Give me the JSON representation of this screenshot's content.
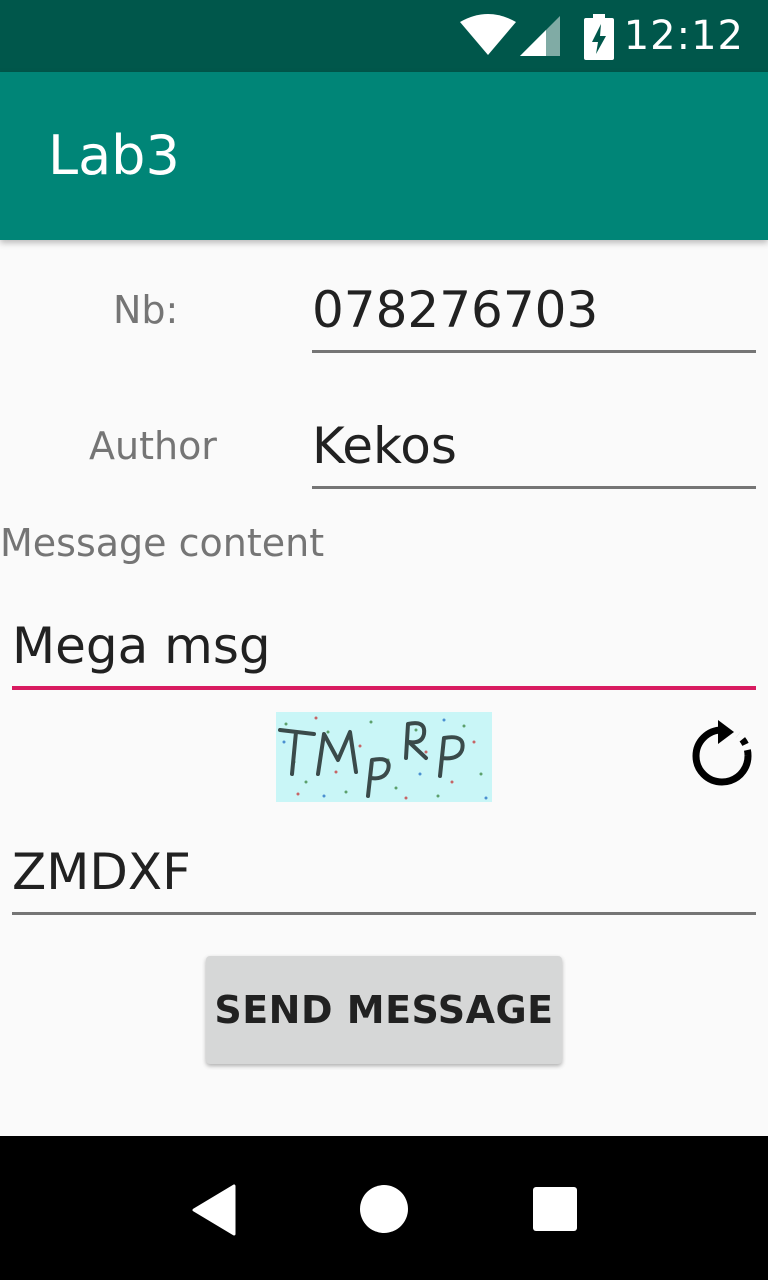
{
  "status_bar": {
    "time": "12:12",
    "icons": [
      "wifi-icon",
      "signal-icon",
      "battery-charging-icon"
    ]
  },
  "app_bar": {
    "title": "Lab3"
  },
  "form": {
    "nb_label": "Nb:",
    "nb_value": "078276703",
    "author_label": "Author",
    "author_value": "Kekos",
    "message_label": "Message content",
    "message_value": "Mega msg",
    "captcha_text": "TMPRP",
    "captcha_input_value": "ZMDXF",
    "send_label": "SEND MESSAGE"
  },
  "colors": {
    "status_bar": "#00574b",
    "app_bar": "#008577",
    "accent": "#d81b60"
  },
  "nav_bar": {
    "icons": [
      "back-icon",
      "home-icon",
      "recents-icon"
    ]
  }
}
